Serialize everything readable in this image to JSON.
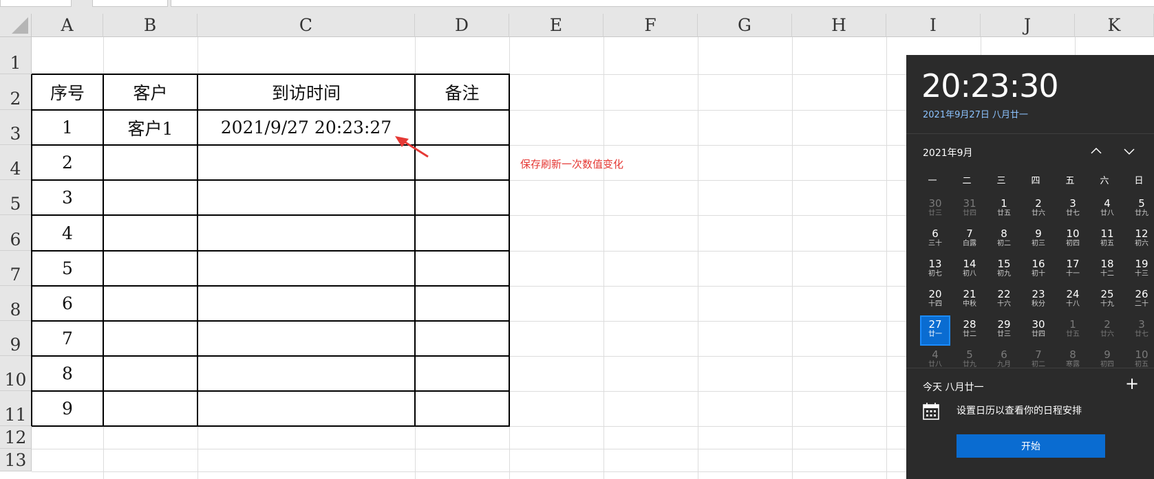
{
  "columns": [
    "A",
    "B",
    "C",
    "D",
    "E",
    "F",
    "G",
    "H",
    "I",
    "J",
    "K"
  ],
  "rows": [
    "1",
    "2",
    "3",
    "4",
    "5",
    "6",
    "7",
    "8",
    "9",
    "10",
    "11",
    "12",
    "13"
  ],
  "table": {
    "headers": [
      "序号",
      "客户",
      "到访时间",
      "备注"
    ],
    "rows": [
      [
        "1",
        "客户1",
        "2021/9/27 20:23:27",
        ""
      ],
      [
        "2",
        "",
        "",
        ""
      ],
      [
        "3",
        "",
        "",
        ""
      ],
      [
        "4",
        "",
        "",
        ""
      ],
      [
        "5",
        "",
        "",
        ""
      ],
      [
        "6",
        "",
        "",
        ""
      ],
      [
        "7",
        "",
        "",
        ""
      ],
      [
        "8",
        "",
        "",
        ""
      ],
      [
        "9",
        "",
        "",
        ""
      ]
    ]
  },
  "annotation": {
    "note": "保存刷新一次数值变化",
    "color": "#e53935"
  },
  "flyout": {
    "time": "20:23:30",
    "date": "2021年9月27日 八月廿一",
    "month_label": "2021年9月",
    "weekdays": [
      "一",
      "二",
      "三",
      "四",
      "五",
      "六",
      "日"
    ],
    "weeks": [
      [
        {
          "d": "30",
          "l": "廿三",
          "m": true
        },
        {
          "d": "31",
          "l": "廿四",
          "m": true
        },
        {
          "d": "1",
          "l": "廿五"
        },
        {
          "d": "2",
          "l": "廿六"
        },
        {
          "d": "3",
          "l": "廿七"
        },
        {
          "d": "4",
          "l": "廿八"
        },
        {
          "d": "5",
          "l": "廿九"
        }
      ],
      [
        {
          "d": "6",
          "l": "三十"
        },
        {
          "d": "7",
          "l": "白露"
        },
        {
          "d": "8",
          "l": "初二"
        },
        {
          "d": "9",
          "l": "初三"
        },
        {
          "d": "10",
          "l": "初四"
        },
        {
          "d": "11",
          "l": "初五"
        },
        {
          "d": "12",
          "l": "初六"
        }
      ],
      [
        {
          "d": "13",
          "l": "初七"
        },
        {
          "d": "14",
          "l": "初八"
        },
        {
          "d": "15",
          "l": "初九"
        },
        {
          "d": "16",
          "l": "初十"
        },
        {
          "d": "17",
          "l": "十一"
        },
        {
          "d": "18",
          "l": "十二"
        },
        {
          "d": "19",
          "l": "十三"
        }
      ],
      [
        {
          "d": "20",
          "l": "十四"
        },
        {
          "d": "21",
          "l": "中秋"
        },
        {
          "d": "22",
          "l": "十六"
        },
        {
          "d": "23",
          "l": "秋分"
        },
        {
          "d": "24",
          "l": "十八"
        },
        {
          "d": "25",
          "l": "十九"
        },
        {
          "d": "26",
          "l": "二十"
        }
      ],
      [
        {
          "d": "27",
          "l": "廿一",
          "t": true
        },
        {
          "d": "28",
          "l": "廿二"
        },
        {
          "d": "29",
          "l": "廿三"
        },
        {
          "d": "30",
          "l": "廿四"
        },
        {
          "d": "1",
          "l": "廿五",
          "m": true
        },
        {
          "d": "2",
          "l": "廿六",
          "m": true
        },
        {
          "d": "3",
          "l": "廿七",
          "m": true
        }
      ],
      [
        {
          "d": "4",
          "l": "廿八",
          "m": true
        },
        {
          "d": "5",
          "l": "廿九",
          "m": true
        },
        {
          "d": "6",
          "l": "九月",
          "m": true
        },
        {
          "d": "7",
          "l": "初二",
          "m": true
        },
        {
          "d": "8",
          "l": "寒露",
          "m": true
        },
        {
          "d": "9",
          "l": "初四",
          "m": true
        },
        {
          "d": "10",
          "l": "初五",
          "m": true
        }
      ]
    ],
    "today_line": "今天 八月廿一",
    "agenda_text": "设置日历以查看你的日程安排",
    "start_button": "开始",
    "accent_color": "#0a6cd1"
  }
}
